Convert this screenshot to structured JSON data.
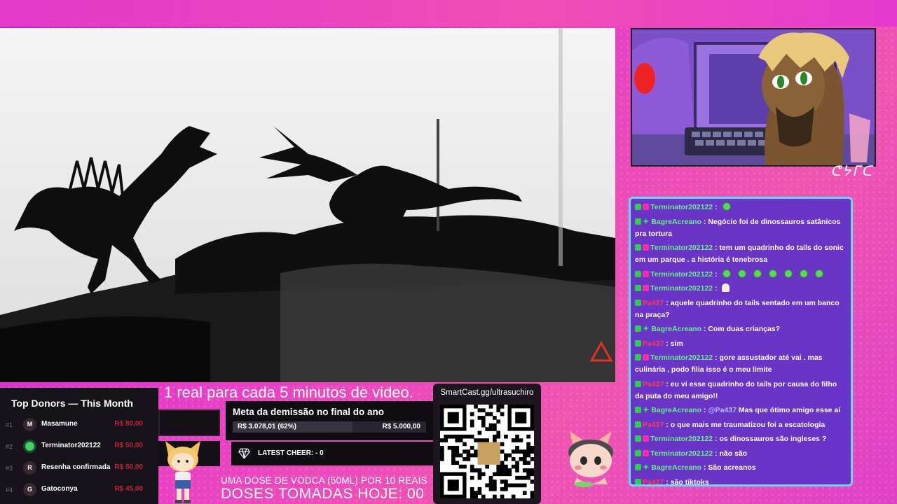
{
  "stream_signature": "ᕦᔭᒥᑕ",
  "subtitle": "1 real para cada 5 minutos de video.",
  "chat": {
    "messages": [
      {
        "user": "Terminator202122",
        "color": "green",
        "badges": [
          "mod",
          "sub"
        ],
        "text": "",
        "emotes": 1
      },
      {
        "user": "BagreAcreano",
        "color": "green",
        "badges": [
          "mod",
          "star"
        ],
        "text": "Negócio foi de dinossauros satânicos pra tortura"
      },
      {
        "user": "Terminator202122",
        "color": "green",
        "badges": [
          "mod",
          "sub"
        ],
        "text": "tem um quadrinho do tails do sonic em um parque . a história é tenebrosa"
      },
      {
        "user": "Terminator202122",
        "color": "green",
        "badges": [
          "mod",
          "sub"
        ],
        "text": "",
        "emotes": 7
      },
      {
        "user": "Terminator202122",
        "color": "green",
        "badges": [
          "mod",
          "sub"
        ],
        "text": "",
        "ghost": true
      },
      {
        "user": "Pa437",
        "color": "red",
        "badges": [
          "mod"
        ],
        "text": "aquele quadrinho do tails sentado em um banco na praça?"
      },
      {
        "user": "BagreAcreano",
        "color": "green",
        "badges": [
          "mod",
          "star"
        ],
        "text": "Com duas crianças?"
      },
      {
        "user": "Pa437",
        "color": "red",
        "badges": [
          "mod"
        ],
        "text": "sim"
      },
      {
        "user": "Terminator202122",
        "color": "green",
        "badges": [
          "mod",
          "sub"
        ],
        "text": "gore assustador até vai . mas culinária , podo filia isso é o meu limite"
      },
      {
        "user": "Pa437",
        "color": "red",
        "badges": [
          "mod"
        ],
        "text": "eu vi esse quadrinho do tails por causa do filho da puta do meu amigo!!"
      },
      {
        "user": "BagreAcreano",
        "color": "green",
        "badges": [
          "mod",
          "star"
        ],
        "mention": "@Pa437",
        "text": "Mas que ótimo amigo esse aí"
      },
      {
        "user": "Pa437",
        "color": "red",
        "badges": [
          "mod"
        ],
        "text": "o que mais me traumatizou foi a escatologia"
      },
      {
        "user": "Terminator202122",
        "color": "green",
        "badges": [
          "mod",
          "sub"
        ],
        "text": "os dinossauros são ingleses ?"
      },
      {
        "user": "Terminator202122",
        "color": "green",
        "badges": [
          "mod",
          "sub"
        ],
        "text": "não são"
      },
      {
        "user": "BagreAcreano",
        "color": "green",
        "badges": [
          "mod",
          "star"
        ],
        "text": "São acreanos"
      },
      {
        "user": "Pa437",
        "color": "red",
        "badges": [
          "mod"
        ],
        "text": "são tiktoks"
      }
    ]
  },
  "donors": {
    "title": "Top Donors — This Month",
    "rows": [
      {
        "rank": "#1",
        "initial": "M",
        "name": "Masamune",
        "amount": "R$ 80,00"
      },
      {
        "rank": "#2",
        "initial": "",
        "name": "Terminator202122",
        "amount": "R$ 50,00"
      },
      {
        "rank": "#3",
        "initial": "R",
        "name": "Resenha confirmada",
        "amount": "R$ 50,00"
      },
      {
        "rank": "#4",
        "initial": "G",
        "name": "Gatoconya",
        "amount": "R$ 45,00"
      }
    ]
  },
  "goal": {
    "title": "Meta da demissão no final do ano",
    "current": "R$ 3.078,01 (62%)",
    "total": "R$ 5.000,00",
    "progress": 0.62
  },
  "cheer": {
    "label": "LATEST CHEER: - 0"
  },
  "vodka": {
    "line1": "UMA DOSE DE VODCA (50ML) POR 10 REAIS",
    "line2": "DOSES TOMADAS HOJE: 00"
  },
  "qr": {
    "label": "SmartCast.gg/ultrasuchiro"
  },
  "colors": {
    "accent": "#e63cc8",
    "chat_bg": "#5e32c8",
    "chat_border": "#6ad8f4",
    "user_green": "#63f08a",
    "user_red": "#ff3860"
  }
}
